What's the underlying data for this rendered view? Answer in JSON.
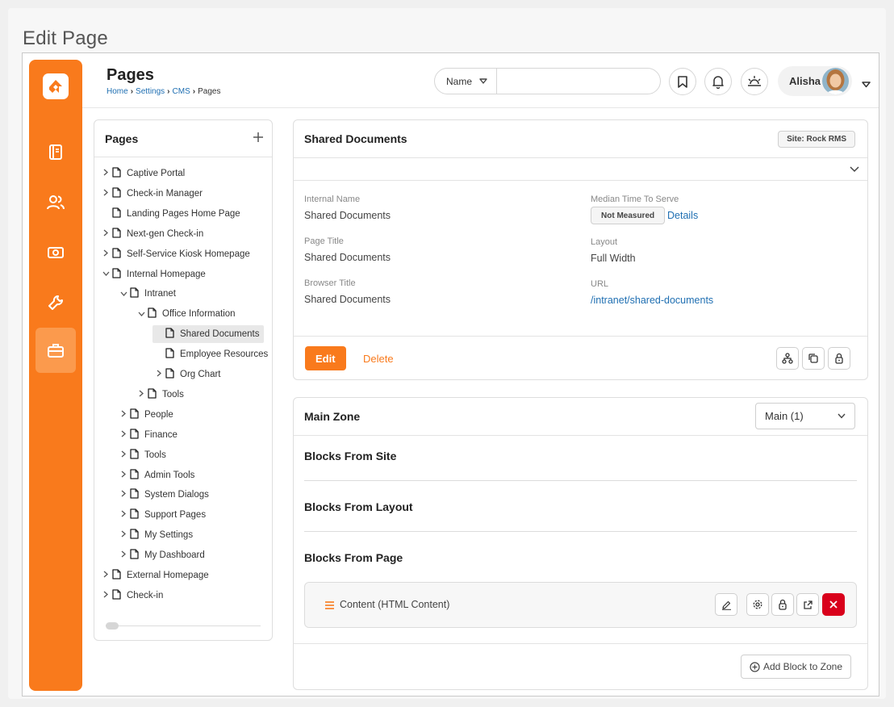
{
  "outer_title": "Edit Page",
  "header": {
    "title": "Pages",
    "breadcrumb": [
      "Home",
      "CMS",
      "Settings",
      "Pages"
    ],
    "search": {
      "scope": "Name",
      "value": "",
      "placeholder": ""
    },
    "user_name": "Alisha"
  },
  "tree": {
    "title": "Pages",
    "items": [
      {
        "label": "Captive Portal",
        "expander": "collapsed",
        "depth": 0
      },
      {
        "label": "Check-in Manager",
        "expander": "collapsed",
        "depth": 0
      },
      {
        "label": "Landing Pages Home Page",
        "expander": "none",
        "depth": 0
      },
      {
        "label": "Next-gen Check-in",
        "expander": "collapsed",
        "depth": 0
      },
      {
        "label": "Self-Service Kiosk Homepage",
        "expander": "collapsed",
        "depth": 0
      },
      {
        "label": "Internal Homepage",
        "expander": "expanded",
        "depth": 0
      },
      {
        "label": "Intranet",
        "expander": "expanded",
        "depth": 1
      },
      {
        "label": "Office Information",
        "expander": "expanded",
        "depth": 2
      },
      {
        "label": "Shared Documents",
        "expander": "none",
        "depth": 3,
        "selected": true
      },
      {
        "label": "Employee Resources",
        "expander": "none",
        "depth": 3
      },
      {
        "label": "Org Chart",
        "expander": "collapsed",
        "depth": 3
      },
      {
        "label": "Tools",
        "expander": "collapsed",
        "depth": 2
      },
      {
        "label": "People",
        "expander": "collapsed",
        "depth": 1
      },
      {
        "label": "Finance",
        "expander": "collapsed",
        "depth": 1
      },
      {
        "label": "Tools",
        "expander": "collapsed",
        "depth": 1
      },
      {
        "label": "Admin Tools",
        "expander": "collapsed",
        "depth": 1
      },
      {
        "label": "System Dialogs",
        "expander": "collapsed",
        "depth": 1
      },
      {
        "label": "Support Pages",
        "expander": "collapsed",
        "depth": 1
      },
      {
        "label": "My Settings",
        "expander": "collapsed",
        "depth": 1
      },
      {
        "label": "My Dashboard",
        "expander": "collapsed",
        "depth": 1
      },
      {
        "label": "External Homepage",
        "expander": "collapsed",
        "depth": 0
      },
      {
        "label": "Check-in",
        "expander": "collapsed",
        "depth": 0
      }
    ]
  },
  "detail": {
    "title": "Shared Documents",
    "site_badge": "Site: Rock RMS",
    "internal_name_label": "Internal Name",
    "internal_name": "Shared Documents",
    "page_title_label": "Page Title",
    "page_title": "Shared Documents",
    "browser_title_label": "Browser Title",
    "browser_title": "Shared Documents",
    "median_label": "Median Time To Serve",
    "median_badge": "Not Measured",
    "median_link": "Details",
    "layout_label": "Layout",
    "layout": "Full Width",
    "url_label": "URL",
    "url": "/intranet/shared-documents",
    "edit_label": "Edit",
    "delete_label": "Delete"
  },
  "zone": {
    "title": "Main Zone",
    "selected": "Main (1)",
    "sections": [
      "Blocks From Site",
      "Blocks From Layout",
      "Blocks From Page"
    ],
    "block_label": "Content (HTML Content)",
    "add_label": "Add Block to Zone"
  },
  "colors": {
    "accent": "#f97a1c",
    "link": "#1f6fb2",
    "danger": "#d9001b"
  }
}
